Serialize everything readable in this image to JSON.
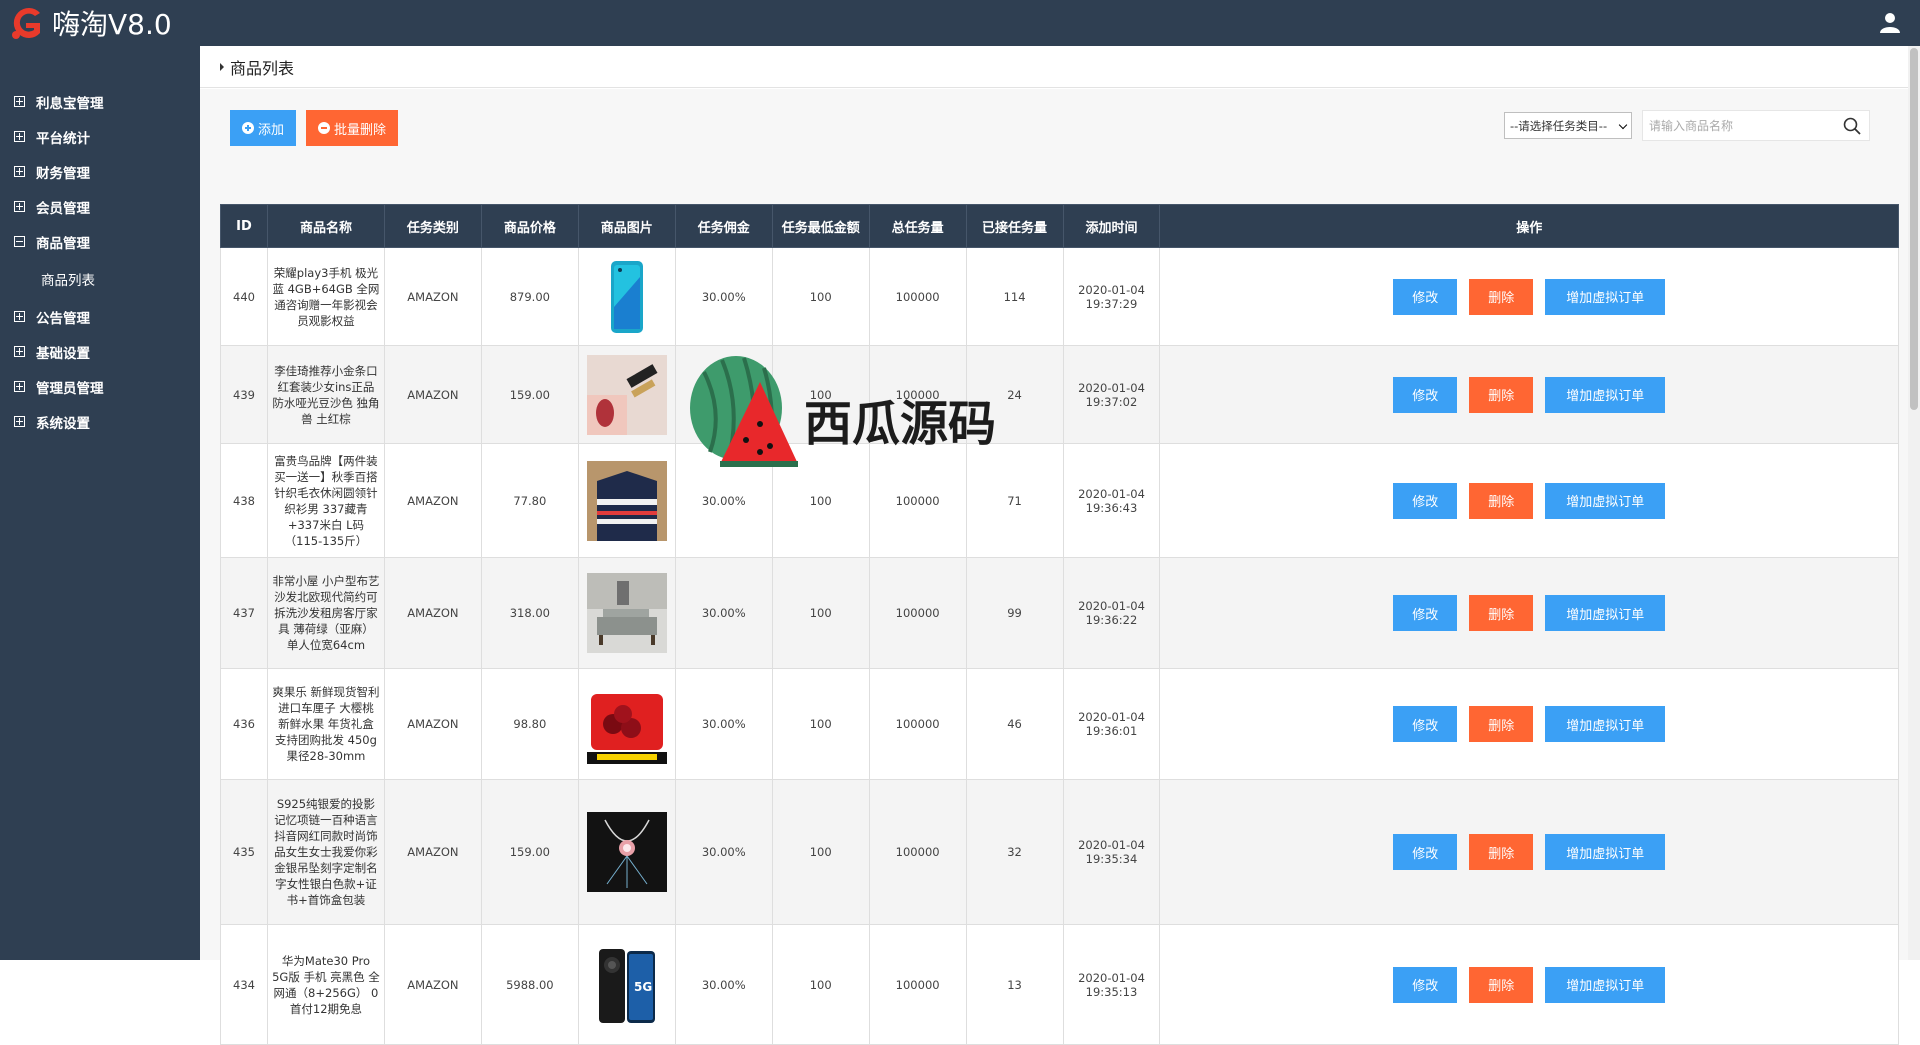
{
  "app": {
    "logo_text": "嗨淘V8.0"
  },
  "sidebar": {
    "items": [
      {
        "label": "利息宝管理"
      },
      {
        "label": "平台统计"
      },
      {
        "label": "财务管理"
      },
      {
        "label": "会员管理"
      },
      {
        "label": "商品管理"
      },
      {
        "label": "公告管理"
      },
      {
        "label": "基础设置"
      },
      {
        "label": "管理员管理"
      },
      {
        "label": "系统设置"
      }
    ],
    "sub_item": "商品列表"
  },
  "panel": {
    "title": "商品列表"
  },
  "toolbar": {
    "add_label": "添加",
    "batch_delete_label": "批量删除"
  },
  "filters": {
    "category_select": "--请选择任务类目--",
    "search_placeholder": "请输入商品名称"
  },
  "table": {
    "headers": [
      "ID",
      "商品名称",
      "任务类别",
      "商品价格",
      "商品图片",
      "任务佣金",
      "任务最低金额",
      "总任务量",
      "已接任务量",
      "添加时间",
      "操作"
    ],
    "action_labels": {
      "edit": "修改",
      "delete": "删除",
      "add_virtual": "增加虚拟订单"
    },
    "rows": [
      {
        "id": "440",
        "name": "荣耀play3手机 极光蓝 4GB+64GB 全网通咨询赠一年影视会员观影权益",
        "category": "AMAZON",
        "price": "879.00",
        "commission": "30.00%",
        "min_amount": "100",
        "total": "100000",
        "taken": "114",
        "date": "2020-01-04",
        "time": "19:37:29",
        "image": "phone-blue"
      },
      {
        "id": "439",
        "name": "李佳琦推荐小金条口红套装少女ins正品防水哑光豆沙色 独角兽 土红棕",
        "category": "AMAZON",
        "price": "159.00",
        "commission": "30.00%",
        "min_amount": "100",
        "total": "100000",
        "taken": "24",
        "date": "2020-01-04",
        "time": "19:37:02",
        "image": "lipstick"
      },
      {
        "id": "438",
        "name": "富贵鸟品牌【两件装 买一送一】秋季百搭针织毛衣休闲圆领针织衫男 337藏青+337米白 L码（115-135斤）",
        "category": "AMAZON",
        "price": "77.80",
        "commission": "30.00%",
        "min_amount": "100",
        "total": "100000",
        "taken": "71",
        "date": "2020-01-04",
        "time": "19:36:43",
        "image": "sweater"
      },
      {
        "id": "437",
        "name": "非常小屋 小户型布艺沙发北欧现代简约可拆洗沙发租房客厅家具 薄荷绿（亚麻） 单人位宽64cm",
        "category": "AMAZON",
        "price": "318.00",
        "commission": "30.00%",
        "min_amount": "100",
        "total": "100000",
        "taken": "99",
        "date": "2020-01-04",
        "time": "19:36:22",
        "image": "sofa"
      },
      {
        "id": "436",
        "name": "爽果乐 新鲜现货智利进口车厘子 大樱桃 新鲜水果 年货礼盒 支持团购批发 450g 果径28-30mm",
        "category": "AMAZON",
        "price": "98.80",
        "commission": "30.00%",
        "min_amount": "100",
        "total": "100000",
        "taken": "46",
        "date": "2020-01-04",
        "time": "19:36:01",
        "image": "cherry"
      },
      {
        "id": "435",
        "name": "S925纯银爱的投影记忆项链一百种语言抖音网红同款时尚饰品女生女士我爱你彩金银吊坠刻字定制名字女性银白色款+证书+首饰盒包装",
        "category": "AMAZON",
        "price": "159.00",
        "commission": "30.00%",
        "min_amount": "100",
        "total": "100000",
        "taken": "32",
        "date": "2020-01-04",
        "time": "19:35:34",
        "image": "necklace"
      },
      {
        "id": "434",
        "name": "华为Mate30 Pro 5G版 手机 亮黑色 全网通（8+256G） 0首付12期免息",
        "category": "AMAZON",
        "price": "5988.00",
        "commission": "30.00%",
        "min_amount": "100",
        "total": "100000",
        "taken": "13",
        "date": "2020-01-04",
        "time": "19:35:13",
        "image": "phone-black"
      }
    ]
  },
  "watermark": {
    "text": "西瓜源码"
  },
  "colors": {
    "header_bg": "#2f3f52",
    "primary": "#3ba0f5",
    "danger": "#ff6633"
  }
}
